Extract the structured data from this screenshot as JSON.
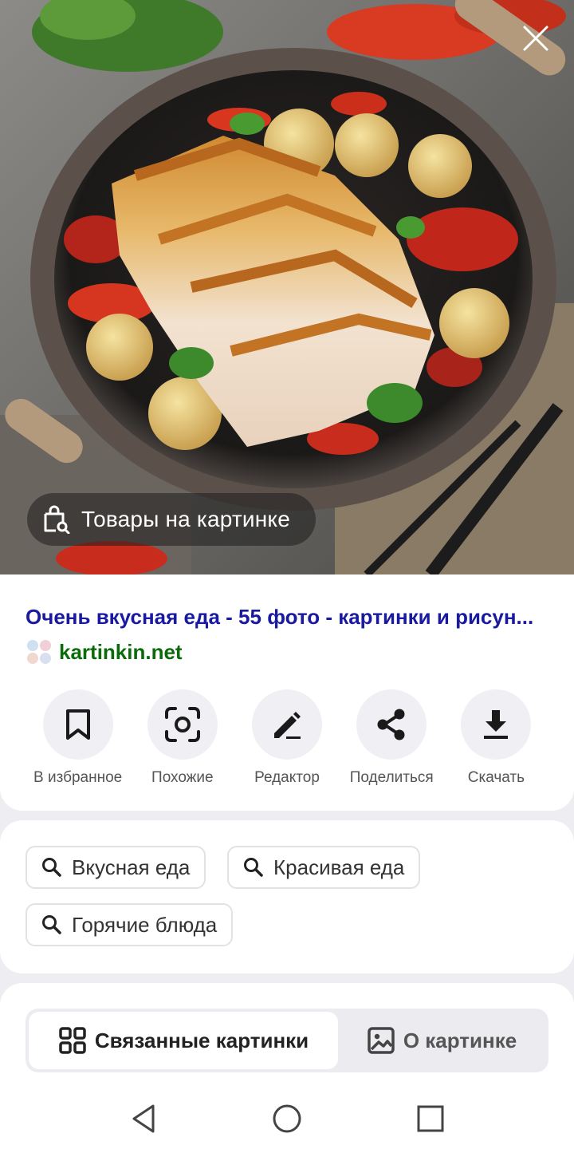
{
  "hero": {
    "shop_label": "Товары на картинке"
  },
  "result": {
    "title": "Очень вкусная еда - 55 фото - картинки и рисун...",
    "domain": "kartinkin.net"
  },
  "actions": [
    {
      "label": "В избранное",
      "icon": "bookmark-icon"
    },
    {
      "label": "Похожие",
      "icon": "lens-scan-icon"
    },
    {
      "label": "Редактор",
      "icon": "pencil-icon"
    },
    {
      "label": "Поделиться",
      "icon": "share-icon"
    },
    {
      "label": "Скачать",
      "icon": "download-icon"
    }
  ],
  "tags": [
    "Вкусная еда",
    "Красивая еда",
    "Горячие блюда"
  ],
  "tabs": {
    "related": "Связанные картинки",
    "about": "О картинке",
    "active": "related"
  },
  "colors": {
    "title": "#1a1aa0",
    "domain": "#0b6b0b"
  }
}
